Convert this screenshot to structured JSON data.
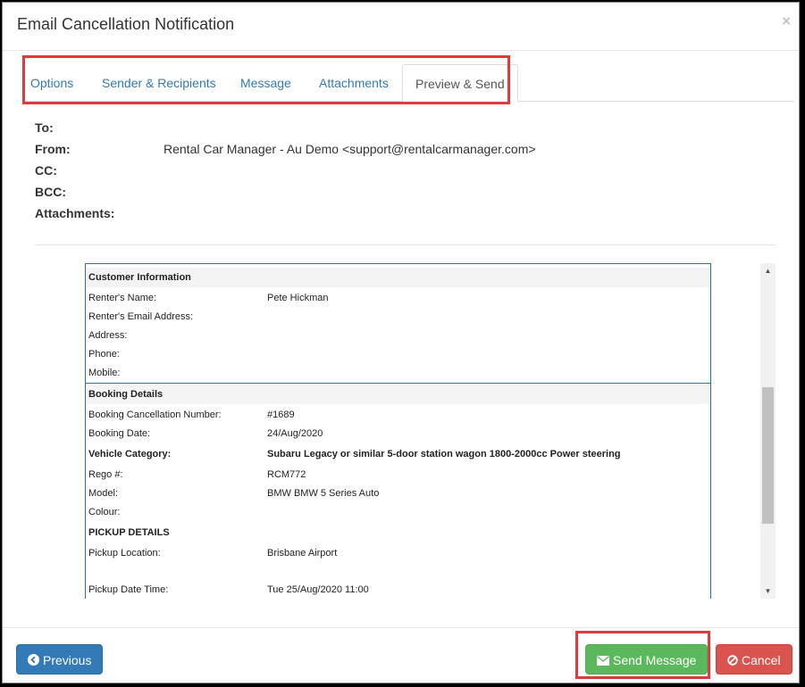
{
  "modal": {
    "title": "Email Cancellation Notification",
    "close_glyph": "×"
  },
  "tabs": [
    {
      "label": "Options",
      "active": false
    },
    {
      "label": "Sender & Recipients",
      "active": false
    },
    {
      "label": "Message",
      "active": false
    },
    {
      "label": "Attachments",
      "active": false
    },
    {
      "label": "Preview & Send",
      "active": true
    }
  ],
  "header_fields": {
    "to_label": "To:",
    "to_value": "",
    "from_label": "From:",
    "from_value": "Rental Car Manager - Au Demo <support@rentalcarmanager.com>",
    "cc_label": "CC:",
    "cc_value": "",
    "bcc_label": "BCC:",
    "bcc_value": "",
    "attachments_label": "Attachments:",
    "attachments_value": ""
  },
  "email_preview": {
    "customer_section": {
      "title": "Customer Information",
      "rows": [
        {
          "label": "Renter's Name:",
          "value": "Pete Hickman"
        },
        {
          "label": "Renter's Email Address:",
          "value": ""
        },
        {
          "label": "Address:",
          "value": ""
        },
        {
          "label": "Phone:",
          "value": ""
        },
        {
          "label": "Mobile:",
          "value": ""
        }
      ]
    },
    "booking_section": {
      "title": "Booking Details",
      "rows": [
        {
          "label": "Booking Cancellation Number:",
          "value": "#1689"
        },
        {
          "label": "Booking Date:",
          "value": "24/Aug/2020"
        },
        {
          "label": "Vehicle Category:",
          "value": "Subaru Legacy or similar 5-door station wagon 1800-2000cc Power steering"
        },
        {
          "label": "Rego #:",
          "value": "RCM772"
        },
        {
          "label": "Model:",
          "value": "BMW BMW 5 Series Auto"
        },
        {
          "label": "Colour:",
          "value": ""
        }
      ]
    },
    "pickup_section": {
      "title": "PICKUP DETAILS",
      "rows": [
        {
          "label": "Pickup Location:",
          "value": "Brisbane Airport"
        },
        {
          "label": "Pickup Date Time:",
          "value": "Tue 25/Aug/2020 11:00"
        }
      ]
    }
  },
  "scrollbar": {
    "up_glyph": "▲",
    "down_glyph": "▼"
  },
  "footer": {
    "previous_label": "Previous",
    "previous_icon": "arrow-circle-left-icon",
    "send_label": "Send Message",
    "send_icon": "envelope-icon",
    "cancel_label": "Cancel",
    "cancel_icon": "ban-icon"
  },
  "colors": {
    "primary": "#337ab7",
    "success": "#5cb85c",
    "danger": "#d9534f",
    "highlight": "#e03a3a"
  }
}
